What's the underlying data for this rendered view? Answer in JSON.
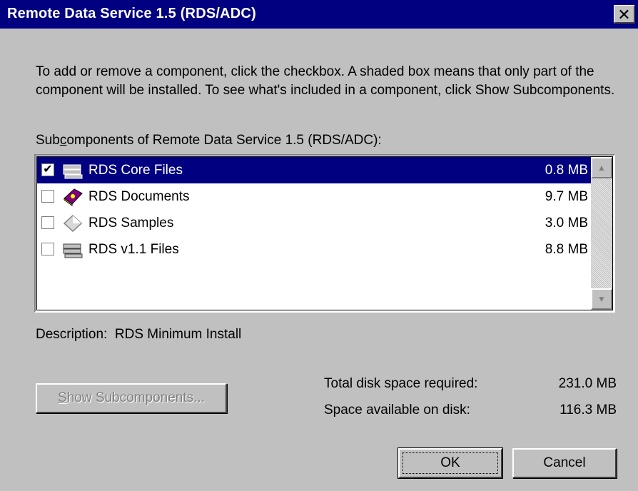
{
  "window": {
    "title": "Remote Data Service 1.5 (RDS/ADC)",
    "close_glyph": "✕"
  },
  "instructions": "To add or remove a component, click the checkbox. A shaded box means that only part of the component will be installed. To see what's included in a component, click Show Subcomponents.",
  "subcomponents_label": {
    "before": "Sub",
    "mnemonic": "c",
    "after": "omponents of Remote Data Service 1.5 (RDS/ADC):"
  },
  "components": [
    {
      "label": "RDS Core Files",
      "size": "0.8 MB",
      "checked": true,
      "selected": true,
      "icon": "drive-stack-icon"
    },
    {
      "label": "RDS Documents",
      "size": "9.7 MB",
      "checked": false,
      "selected": false,
      "icon": "book-icon"
    },
    {
      "label": "RDS Samples",
      "size": "3.0 MB",
      "checked": false,
      "selected": false,
      "icon": "diamond-icon"
    },
    {
      "label": "RDS v1.1 Files",
      "size": "8.8 MB",
      "checked": false,
      "selected": false,
      "icon": "drive-stack-icon"
    }
  ],
  "description": {
    "label": "Description:",
    "value": "RDS Minimum Install"
  },
  "show_subcomponents": {
    "mnemonic": "S",
    "rest": "how Subcomponents..."
  },
  "disk": {
    "required_label": "Total disk space required:",
    "required_value": "231.0 MB",
    "available_label": "Space available on disk:",
    "available_value": "116.3 MB"
  },
  "buttons": {
    "ok": "OK",
    "cancel": "Cancel"
  },
  "colors": {
    "titlebar": "#000080",
    "face": "#c0c0c0",
    "selection": "#000080"
  }
}
